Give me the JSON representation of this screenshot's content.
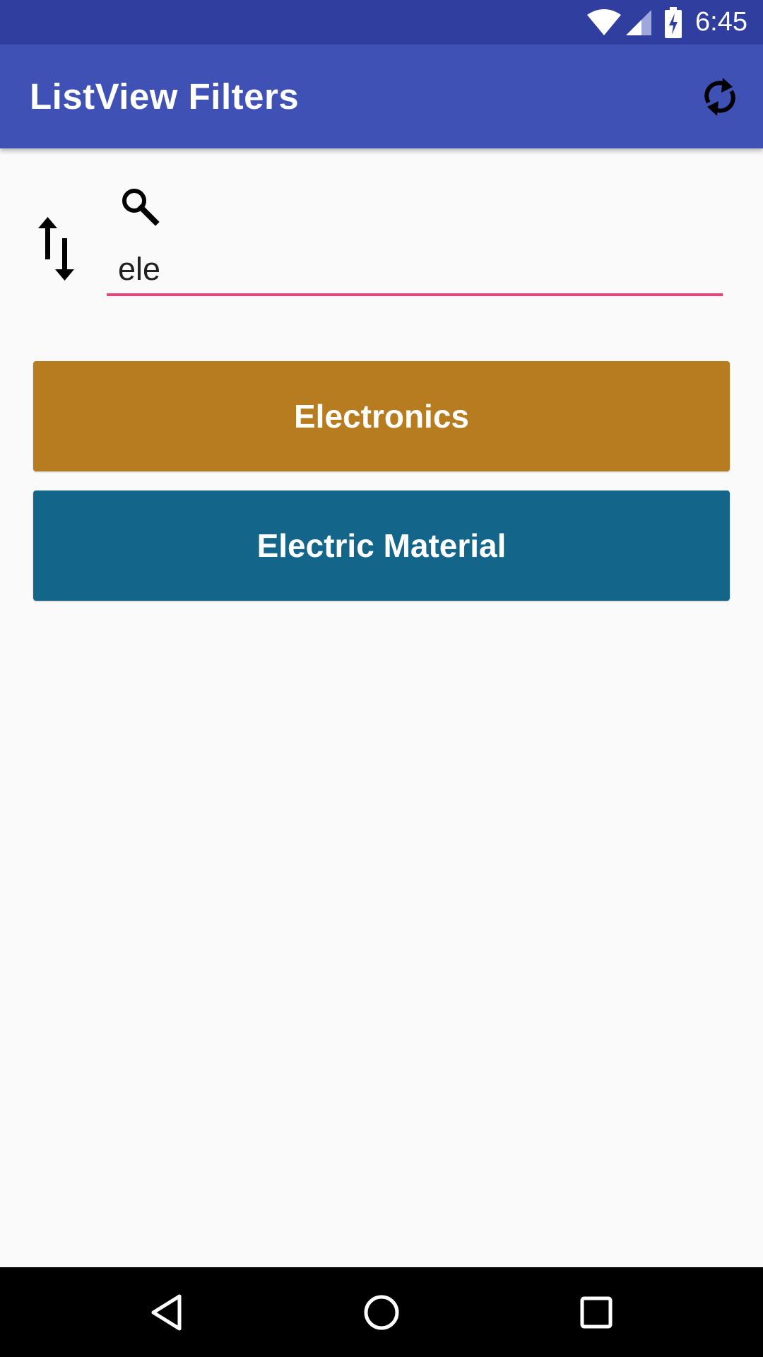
{
  "status_bar": {
    "time": "6:45",
    "icons": [
      "wifi-icon",
      "signal-icon",
      "battery-charging-icon"
    ],
    "background": "#303F9F"
  },
  "app_bar": {
    "title": "ListView Filters",
    "action_icon": "refresh-icon",
    "background": "#3F51B5"
  },
  "filter": {
    "sort_icon": "sort-icon",
    "search_icon": "search-icon",
    "query": "ele",
    "underline_color": "#EC407A"
  },
  "list": {
    "items": [
      {
        "label": "Electronics",
        "color": "#B87C20"
      },
      {
        "label": "Electric Material",
        "color": "#136689"
      }
    ]
  },
  "nav_bar": {
    "buttons": [
      "back-icon",
      "home-icon",
      "recents-icon"
    ]
  }
}
